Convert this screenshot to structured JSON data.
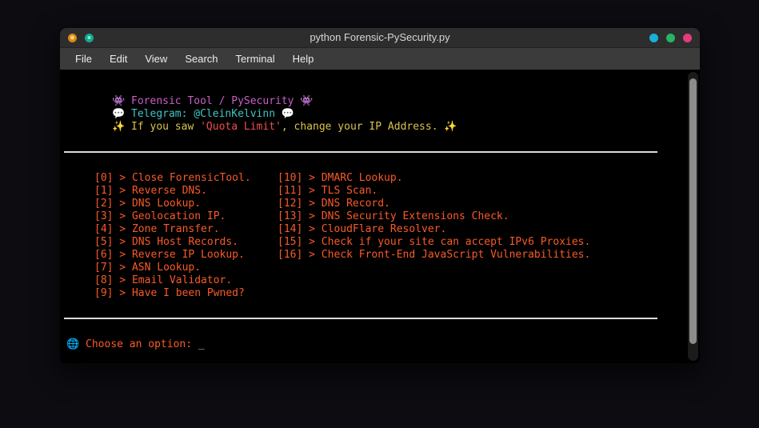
{
  "window": {
    "title": "python Forensic-PySecurity.py",
    "menu": [
      "File",
      "Edit",
      "View",
      "Search",
      "Terminal",
      "Help"
    ]
  },
  "terminal": {
    "banner": {
      "title_line": "👾 Forensic Tool / PySecurity 👾",
      "telegram_line": "💬 Telegram: @CleinKelvinn 💬",
      "notice_prefix": "✨ If you saw ",
      "notice_highlight": "'Quota Limit'",
      "notice_suffix": ", change your IP Address. ✨"
    },
    "options_left": [
      "[0] > Close ForensicTool.",
      "[1] > Reverse DNS.",
      "[2] > DNS Lookup.",
      "[3] > Geolocation IP.",
      "[4] > Zone Transfer.",
      "[5] > DNS Host Records.",
      "[6] > Reverse IP Lookup.",
      "[7] > ASN Lookup.",
      "[8] > Email Validator.",
      "[9] > Have I been Pwned?"
    ],
    "options_right": [
      "[10] > DMARC Lookup.",
      "[11] > TLS Scan.",
      "[12] > DNS Record.",
      "[13] > DNS Security Extensions Check.",
      "[14] > CloudFlare Resolver.",
      "[15] > Check if your site can accept IPv6 Proxies.",
      "[16] > Check Front-End JavaScript Vulnerabilities."
    ],
    "prompt": "🌐 Choose an option: ",
    "cursor": "_"
  },
  "colors": {
    "banner_title": "#c95fc9",
    "telegram": "#3fc6c6",
    "notice": "#d9c24a",
    "notice_highlight": "#f14c4c",
    "options": "#fa5a28",
    "prompt": "#fa5a28",
    "separator": "#dcdcdc",
    "titlebar_bg": "#2d2d2d",
    "menubar_bg": "#3b3b3b",
    "terminal_bg": "#000000"
  }
}
